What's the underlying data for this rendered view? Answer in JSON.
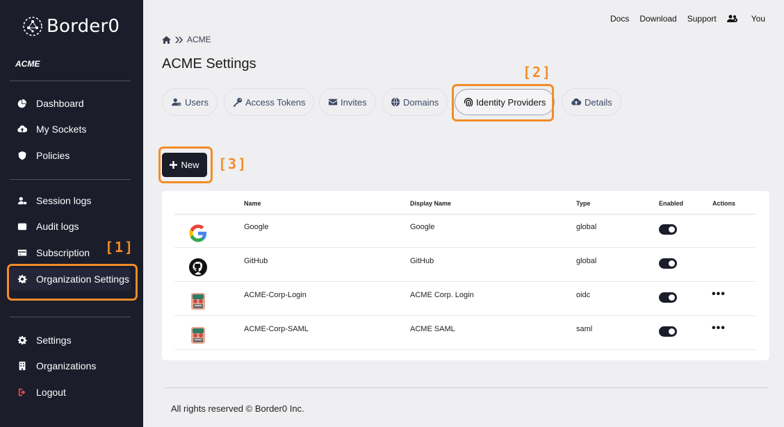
{
  "brand": {
    "name": "Border0"
  },
  "sidebar": {
    "org": "ACME",
    "items": [
      {
        "label": "Dashboard",
        "icon": "chart-pie-icon"
      },
      {
        "label": "My Sockets",
        "icon": "cloud-upload-icon"
      },
      {
        "label": "Policies",
        "icon": "shield-icon"
      },
      {
        "label": "Session logs",
        "icon": "user-lock-icon"
      },
      {
        "label": "Audit logs",
        "icon": "wallet-icon"
      },
      {
        "label": "Subscription",
        "icon": "credit-card-icon"
      },
      {
        "label": "Organization Settings",
        "icon": "gear-icon"
      },
      {
        "label": "Settings",
        "icon": "gear-icon"
      },
      {
        "label": "Organizations",
        "icon": "building-icon"
      },
      {
        "label": "Logout",
        "icon": "sign-out-icon"
      }
    ]
  },
  "annotations": {
    "a1": "[1]",
    "a2": "[2]",
    "a3": "[3]",
    "color": "#f28c28"
  },
  "topnav": {
    "docs": "Docs",
    "download": "Download",
    "support": "Support",
    "you": "You"
  },
  "breadcrumb": {
    "current": "ACME"
  },
  "page": {
    "title": "ACME Settings"
  },
  "tabs": [
    {
      "label": "Users",
      "icon": "user-cog-icon"
    },
    {
      "label": "Access Tokens",
      "icon": "key-icon"
    },
    {
      "label": "Invites",
      "icon": "envelope-icon"
    },
    {
      "label": "Domains",
      "icon": "globe-icon"
    },
    {
      "label": "Identity Providers",
      "icon": "fingerprint-icon",
      "active": true
    },
    {
      "label": "Details",
      "icon": "cloud-upload-icon"
    }
  ],
  "new_button": {
    "label": "New"
  },
  "table": {
    "headers": {
      "name": "Name",
      "display_name": "Display Name",
      "type": "Type",
      "enabled": "Enabled",
      "actions": "Actions"
    },
    "rows": [
      {
        "icon": "google-icon",
        "name": "Google",
        "display_name": "Google",
        "type": "global",
        "enabled": true,
        "has_actions": false
      },
      {
        "icon": "github-icon",
        "name": "GitHub",
        "display_name": "GitHub",
        "type": "global",
        "enabled": true,
        "has_actions": false
      },
      {
        "icon": "acme-logo-icon",
        "name": "ACME-Corp-Login",
        "display_name": "ACME Corp. Login",
        "type": "oidc",
        "enabled": true,
        "has_actions": true
      },
      {
        "icon": "acme-logo-icon",
        "name": "ACME-Corp-SAML",
        "display_name": "ACME SAML",
        "type": "saml",
        "enabled": true,
        "has_actions": true
      }
    ]
  },
  "footer": {
    "text": "All rights reserved © Border0 Inc."
  },
  "colors": {
    "sidebar_bg": "#1c1d2b",
    "accent": "#f28c28",
    "page_bg": "#efeff1"
  }
}
